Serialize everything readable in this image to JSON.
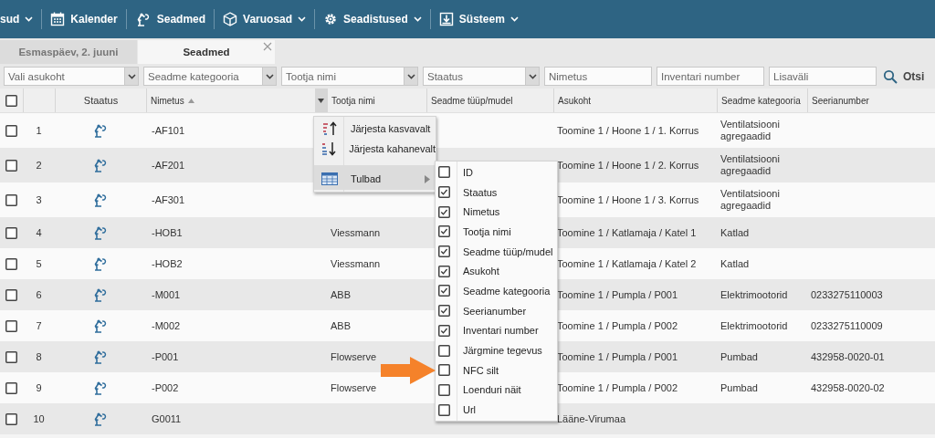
{
  "nav": {
    "items": [
      {
        "label": "sud",
        "dropdown": true
      },
      {
        "label": "Kalender",
        "dropdown": false
      },
      {
        "label": "Seadmed",
        "dropdown": false
      },
      {
        "label": "Varuosad",
        "dropdown": true
      },
      {
        "label": "Seadistused",
        "dropdown": true
      },
      {
        "label": "Süsteem",
        "dropdown": true
      }
    ]
  },
  "tabs": [
    {
      "label": "Esmaspäev, 2. juuni",
      "selected": false,
      "closable": false
    },
    {
      "label": "Seadmed",
      "selected": true,
      "closable": true
    }
  ],
  "filters": [
    {
      "kind": "select",
      "placeholder": "Vali asukoht"
    },
    {
      "kind": "select",
      "placeholder": "Seadme kategooria"
    },
    {
      "kind": "select",
      "placeholder": "Tootja nimi"
    },
    {
      "kind": "select",
      "placeholder": "Staatus"
    },
    {
      "kind": "input",
      "placeholder": "Nimetus"
    },
    {
      "kind": "input",
      "placeholder": "Inventari number"
    },
    {
      "kind": "input",
      "placeholder": "Lisaväli"
    }
  ],
  "search_button": {
    "label": "Otsi"
  },
  "table": {
    "select_all_checked": false,
    "columns": [
      {
        "label": "Staatus",
        "sorted": false,
        "menu_open": false
      },
      {
        "label": "Nimetus",
        "sorted": true,
        "menu_open": true
      },
      {
        "label": "Tootja nimi",
        "sorted": false,
        "menu_open": false
      },
      {
        "label": "Seadme tüüp/mudel",
        "sorted": false,
        "menu_open": false
      },
      {
        "label": "Asukoht",
        "sorted": false,
        "menu_open": false
      },
      {
        "label": "Seadme kategooria",
        "sorted": false,
        "menu_open": false
      },
      {
        "label": "Seerianumber",
        "sorted": false,
        "menu_open": false
      }
    ],
    "rows": [
      {
        "checked": false,
        "number": "1",
        "name": "-AF101",
        "location": "Toomine 1 / Hoone 1 / 1. Korrus",
        "category": "Ventilatsiooni agregaadid"
      },
      {
        "checked": false,
        "number": "2",
        "name": "-AF201",
        "location": "Toomine 1 / Hoone 1 / 2. Korrus",
        "category": "Ventilatsiooni agregaadid"
      },
      {
        "checked": false,
        "number": "3",
        "name": "-AF301",
        "location": "Toomine 1 / Hoone 1 / 3. Korrus",
        "category": "Ventilatsiooni agregaadid"
      },
      {
        "checked": false,
        "number": "4",
        "name": "-HOB1",
        "manufacturer": "Viessmann",
        "location": "Toomine 1 / Katlamaja / Katel 1",
        "category": "Katlad"
      },
      {
        "checked": false,
        "number": "5",
        "name": "-HOB2",
        "manufacturer": "Viessmann",
        "location": "Toomine 1 / Katlamaja / Katel 2",
        "category": "Katlad"
      },
      {
        "checked": false,
        "number": "6",
        "name": "-M001",
        "manufacturer": "ABB",
        "location": "Toomine 1 / Pumpla / P001",
        "category": "Elektrimootorid",
        "serial": "0233275110003"
      },
      {
        "checked": false,
        "number": "7",
        "name": "-M002",
        "manufacturer": "ABB",
        "location": "Toomine 1 / Pumpla / P002",
        "category": "Elektrimootorid",
        "serial": "0233275110009"
      },
      {
        "checked": false,
        "number": "8",
        "name": "-P001",
        "manufacturer": "Flowserve",
        "location": "Toomine 1 / Pumpla / P001",
        "category": "Pumbad",
        "serial": "432958-0020-01"
      },
      {
        "checked": false,
        "number": "9",
        "name": "-P002",
        "manufacturer": "Flowserve",
        "location": "Toomine 1 / Pumpla / P002",
        "category": "Pumbad",
        "serial": "432958-0020-02"
      },
      {
        "checked": false,
        "number": "10",
        "name": "G0011",
        "location": "Lääne-Virumaa"
      }
    ]
  },
  "column_menu": {
    "items": [
      {
        "label": "Järjesta kasvavalt",
        "separator_before": false,
        "expanded": false
      },
      {
        "label": "Järjesta kahanevalt",
        "separator_before": false,
        "expanded": false
      },
      {
        "label": "Tulbad",
        "separator_before": true,
        "expanded": true
      }
    ],
    "columns_submenu": [
      {
        "label": "ID",
        "checked": false,
        "pointed": false
      },
      {
        "label": "Staatus",
        "checked": true,
        "pointed": false
      },
      {
        "label": "Nimetus",
        "checked": true,
        "pointed": false
      },
      {
        "label": "Tootja nimi",
        "checked": true,
        "pointed": false
      },
      {
        "label": "Seadme tüüp/mudel",
        "checked": true,
        "pointed": false
      },
      {
        "label": "Asukoht",
        "checked": true,
        "pointed": false
      },
      {
        "label": "Seadme kategooria",
        "checked": true,
        "pointed": false
      },
      {
        "label": "Seerianumber",
        "checked": true,
        "pointed": false
      },
      {
        "label": "Inventari number",
        "checked": true,
        "pointed": false
      },
      {
        "label": "Järgmine tegevus",
        "checked": false,
        "pointed": false
      },
      {
        "label": "NFC silt",
        "checked": false,
        "pointed": true
      },
      {
        "label": "Loenduri näit",
        "checked": false,
        "pointed": false
      },
      {
        "label": "Url",
        "checked": false,
        "pointed": false
      }
    ]
  }
}
